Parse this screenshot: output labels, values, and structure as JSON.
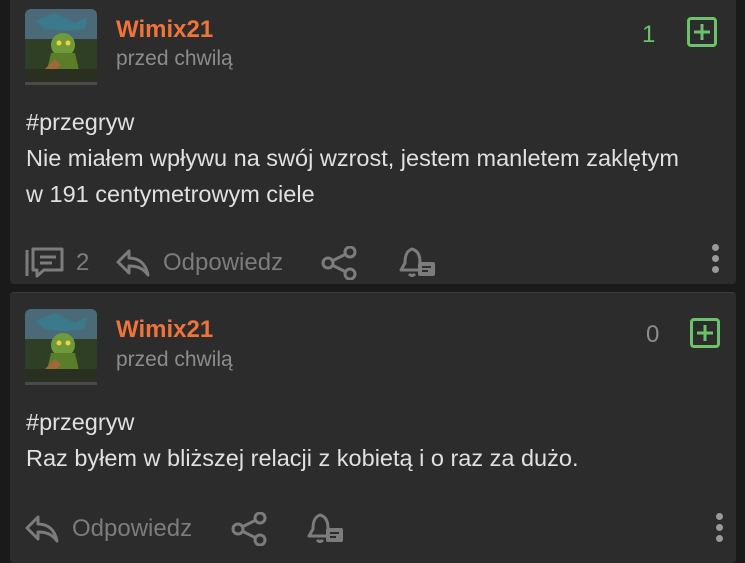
{
  "posts": [
    {
      "author": "Wimix21",
      "time": "przed chwilą",
      "votes": "1",
      "tag": "#przegryw",
      "text": "Nie miałem wpływu na swój wzrost, jestem manletem zaklętym w 191 centymetrowym ciele",
      "comments": "2",
      "reply_label": "Odpowiedz",
      "vote_color": "#6cc26c"
    },
    {
      "author": "Wimix21",
      "time": "przed chwilą",
      "votes": "0",
      "tag": "#przegryw",
      "text": "Raz byłem w bliższej relacji z kobietą i o raz za dużo.",
      "reply_label": "Odpowiedz",
      "vote_color": "#8c8c8c"
    }
  ],
  "colors": {
    "username": "#f0733a",
    "plus": "#6cc26c",
    "background": "#1a1a1a",
    "card": "#2c2c2c"
  },
  "icons": [
    "comments-icon",
    "reply-icon",
    "share-icon",
    "notify-bell-icon",
    "more-vertical-icon",
    "plus-box-icon"
  ]
}
